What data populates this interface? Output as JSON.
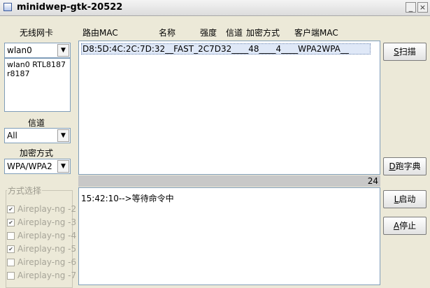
{
  "window": {
    "title": "minidwep-gtk-20522",
    "minimize": "_",
    "close": "×"
  },
  "left": {
    "nic_label": "无线网卡",
    "nic_value": "wlan0",
    "nic_info": [
      "wlan0 RTL8187",
      "r8187"
    ],
    "channel_label": "信道",
    "channel_value": "All",
    "encryption_label": "加密方式",
    "encryption_value": "WPA/WPA2",
    "mode_group_title": "方式选择",
    "modes": [
      {
        "label": "Aireplay-ng -2",
        "checked": true
      },
      {
        "label": "Aireplay-ng -3",
        "checked": true
      },
      {
        "label": "Aireplay-ng -4",
        "checked": false
      },
      {
        "label": "Aireplay-ng -5",
        "checked": true
      },
      {
        "label": "Aireplay-ng -6",
        "checked": false
      },
      {
        "label": "Aireplay-ng -7",
        "checked": false
      }
    ]
  },
  "table": {
    "headers": [
      "路由MAC",
      "名称",
      "强度",
      "信道",
      "加密方式",
      "客户端MAC"
    ],
    "rows": [
      "D8:5D:4C:2C:7D:32__FAST_2C7D32____48____4____WPA2WPA__"
    ]
  },
  "progress": {
    "value": "24"
  },
  "log": {
    "lines": [
      "15:42:10-->等待命令中"
    ]
  },
  "buttons": {
    "scan": {
      "key": "S",
      "text": "扫描"
    },
    "dict": {
      "key": "D",
      "text": "跑字典"
    },
    "start": {
      "key": "L",
      "text": "启动"
    },
    "stop": {
      "key": "A",
      "text": "停止"
    }
  }
}
